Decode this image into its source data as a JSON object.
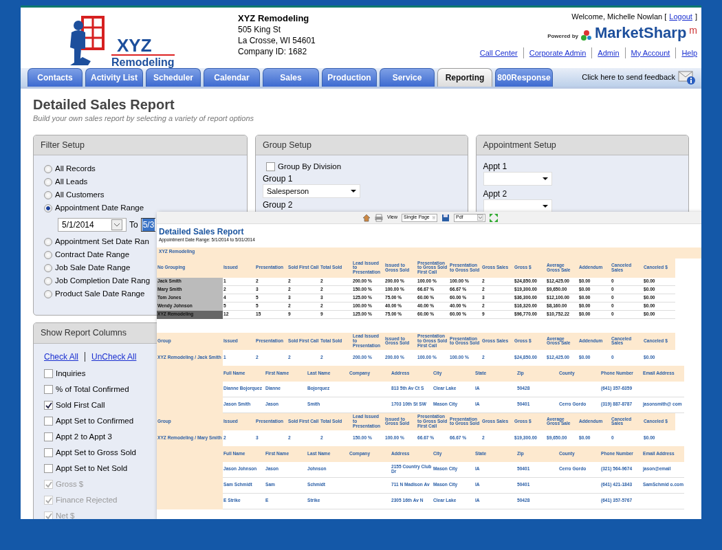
{
  "header": {
    "logo_line1": "XYZ",
    "logo_line2": "Remodeling",
    "company_name": "XYZ Remodeling",
    "company_lines": [
      "505 King St",
      "La Crosse, WI 54601",
      "Company ID: 1682"
    ],
    "welcome": "Welcome, Michelle Nowlan [",
    "logout": "Logout",
    "welcome_end": "]",
    "powered_by": "Powered by",
    "brand": "MarketSharp",
    "brand_mark": "m",
    "links": [
      "Call Center",
      "Corporate Admin",
      "Admin",
      "My Account",
      "Help"
    ]
  },
  "tabs": [
    {
      "label": "Contacts",
      "selected": false
    },
    {
      "label": "Activity List",
      "selected": false
    },
    {
      "label": "Scheduler",
      "selected": false
    },
    {
      "label": "Calendar",
      "selected": false
    },
    {
      "label": "Sales",
      "selected": false
    },
    {
      "label": "Production",
      "selected": false
    },
    {
      "label": "Service",
      "selected": false
    },
    {
      "label": "Reporting",
      "selected": true
    },
    {
      "label": "800Response",
      "selected": false
    }
  ],
  "feedback": "Click here to send feedback",
  "page": {
    "title": "Detailed Sales Report",
    "subtitle": "Build your own sales report by selecting a variety of report options"
  },
  "filter_setup": {
    "title": "Filter Setup",
    "options": [
      {
        "label": "All Records",
        "selected": false
      },
      {
        "label": "All Leads",
        "selected": false
      },
      {
        "label": "All Customers",
        "selected": false
      },
      {
        "label": "Appointment Date Range",
        "selected": true
      },
      {
        "label": "Appointment Set Date Ran",
        "selected": false
      },
      {
        "label": "Contract Date Range",
        "selected": false
      },
      {
        "label": "Job Sale Date Range",
        "selected": false
      },
      {
        "label": "Job Completion Date Rang",
        "selected": false
      },
      {
        "label": "Product Sale Date Range",
        "selected": false
      }
    ],
    "date_from": "5/1/2014",
    "to_label": "To",
    "date_to": "5/3"
  },
  "group_setup": {
    "title": "Group Setup",
    "division_label": "Group By Division",
    "division_checked": false,
    "group1_label": "Group 1",
    "group1_value": "Salesperson",
    "group2_label": "Group 2"
  },
  "appointment_setup": {
    "title": "Appointment Setup",
    "appt1_label": "Appt 1",
    "appt2_label": "Appt 2"
  },
  "columns_panel": {
    "title": "Show Report Columns",
    "check_all": "Check All",
    "uncheck_all": "UnCheck All",
    "items": [
      {
        "label": "Inquiries",
        "checked": false,
        "disabled": false
      },
      {
        "label": "% of Total Confirmed",
        "checked": false,
        "disabled": false
      },
      {
        "label": "Sold First Call",
        "checked": true,
        "disabled": false
      },
      {
        "label": "Appt Set to Confirmed",
        "checked": false,
        "disabled": false
      },
      {
        "label": "Appt 2 to Appt 3",
        "checked": false,
        "disabled": false
      },
      {
        "label": "Appt Set to Gross Sold",
        "checked": false,
        "disabled": false
      },
      {
        "label": "Appt Set to Net Sold",
        "checked": false,
        "disabled": false
      },
      {
        "label": "Gross $",
        "checked": true,
        "disabled": true
      },
      {
        "label": "Finance Rejected",
        "checked": true,
        "disabled": true
      },
      {
        "label": "Net $",
        "checked": true,
        "disabled": true
      }
    ]
  },
  "report": {
    "view_label": "View",
    "view_value": "Single Page",
    "export_value": "Pdf",
    "title": "Detailed Sales Report",
    "subtitle": "Appointment Date Range: 5/1/2014 to 5/31/2014",
    "company": "XYZ Remodeling",
    "summary_columns": [
      "No Grouping",
      "Issued",
      "Presentation",
      "Sold First Call",
      "Total Sold",
      "Lead Issued to Presentation",
      "Issued to Gross Sold",
      "Presentation to Gross Sold First Call",
      "Presentation to Gross Sold",
      "Gross Sales",
      "Gross $",
      "Average Gross Sale",
      "Addendum",
      "Canceled Sales",
      "Canceled $"
    ],
    "summary_rows": [
      {
        "total": false,
        "cells": [
          "Jack Smith",
          "1",
          "2",
          "2",
          "2",
          "200.00 %",
          "200.00 %",
          "100.00 %",
          "100.00 %",
          "2",
          "$24,850.00",
          "$12,425.00",
          "$0.00",
          "0",
          "$0.00"
        ]
      },
      {
        "total": false,
        "cells": [
          "Mary Smith",
          "2",
          "3",
          "2",
          "2",
          "150.00 %",
          "100.00 %",
          "66.67 %",
          "66.67 %",
          "2",
          "$19,300.00",
          "$9,650.00",
          "$0.00",
          "0",
          "$0.00"
        ]
      },
      {
        "total": false,
        "cells": [
          "Tom Jones",
          "4",
          "5",
          "3",
          "3",
          "125.00 %",
          "75.00 %",
          "60.00 %",
          "60.00 %",
          "3",
          "$36,300.00",
          "$12,100.00",
          "$0.00",
          "0",
          "$0.00"
        ]
      },
      {
        "total": false,
        "cells": [
          "Wendy Johnson",
          "5",
          "5",
          "2",
          "2",
          "100.00 %",
          "40.00 %",
          "40.00 %",
          "40.00 %",
          "2",
          "$16,320.00",
          "$8,160.00",
          "$0.00",
          "0",
          "$0.00"
        ]
      },
      {
        "total": true,
        "cells": [
          "XYZ Remodeling",
          "12",
          "15",
          "9",
          "9",
          "125.00 %",
          "75.00 %",
          "60.00 %",
          "60.00 %",
          "9",
          "$96,770.00",
          "$10,752.22",
          "$0.00",
          "0",
          "$0.00"
        ]
      }
    ],
    "groups": [
      {
        "columns": [
          "Group",
          "Issued",
          "Presentation",
          "Sold First Call",
          "Total Sold",
          "Lead Issued to Presentation",
          "Issued to Gross Sold",
          "Presentation to Gross Sold First Call",
          "Presentation to Gross Sold",
          "Gross Sales",
          "Gross $",
          "Average Gross Sale",
          "Addendum",
          "Canceled Sales",
          "Canceled $"
        ],
        "row": [
          "XYZ Remodeling / Jack Smith",
          "1",
          "2",
          "2",
          "2",
          "200.00 %",
          "200.00 %",
          "100.00 %",
          "100.00 %",
          "2",
          "$24,850.00",
          "$12,425.00",
          "$0.00",
          "0",
          "$0.00"
        ],
        "detail_columns": [
          "Full Name",
          "First Name",
          "Last Name",
          "Company",
          "Address",
          "City",
          "State",
          "Zip",
          "County",
          "Phone Number",
          "Email Address"
        ],
        "details": [
          {
            "cells": [
              "Dianne Bojorquez",
              "Dianne",
              "Bojorquez",
              "",
              "813 5th Av Ct S",
              "Clear Lake",
              "IA",
              "50428",
              "",
              "(641) 357-6359",
              ""
            ]
          },
          {
            "cells": [
              "Jason Smith",
              "Jason",
              "Smith",
              "",
              "1703 10th St SW",
              "Mason City",
              "IA",
              "50401",
              "Cerro Gordo",
              "(319) 887-8787",
              "jasonsmith@ com"
            ]
          }
        ]
      },
      {
        "columns": [
          "Group",
          "Issued",
          "Presentation",
          "Sold First Call",
          "Total Sold",
          "Lead Issued to Presentation",
          "Issued to Gross Sold",
          "Presentation to Gross Sold First Call",
          "Presentation to Gross Sold",
          "Gross Sales",
          "Gross $",
          "Average Gross Sale",
          "Addendum",
          "Canceled Sales",
          "Canceled $"
        ],
        "row": [
          "XYZ Remodeling / Mary Smith",
          "2",
          "3",
          "2",
          "2",
          "150.00 %",
          "100.00 %",
          "66.67 %",
          "66.67 %",
          "2",
          "$19,300.00",
          "$9,650.00",
          "$0.00",
          "0",
          "$0.00"
        ],
        "detail_columns": [
          "Full Name",
          "First Name",
          "Last Name",
          "Company",
          "Address",
          "City",
          "State",
          "Zip",
          "County",
          "Phone Number",
          "Email Address"
        ],
        "details": [
          {
            "cells": [
              "Jason Johnson",
              "Jason",
              "Johnson",
              "",
              "2155 Country Club Dr",
              "Mason City",
              "IA",
              "50401",
              "Cerro Gordo",
              "(321) 564-9674",
              "jason@email"
            ]
          },
          {
            "cells": [
              "Sam Schmidt",
              "Sam",
              "Schmidt",
              "",
              "711 N Madison Av",
              "Mason City",
              "IA",
              "50401",
              "",
              "(641) 421-1843",
              "SamSchmid o.com"
            ]
          },
          {
            "cells": [
              "E Strike",
              "E",
              "Strike",
              "",
              "2305 16th Av N",
              "Clear Lake",
              "IA",
              "50428",
              "",
              "(641) 357-5767",
              ""
            ]
          }
        ]
      }
    ]
  }
}
